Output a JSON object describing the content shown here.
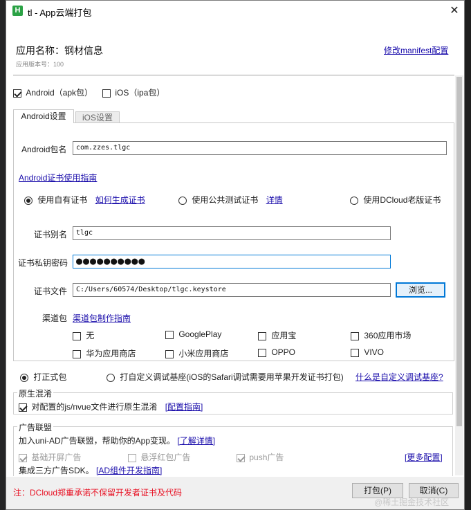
{
  "window": {
    "title": "tl - App云端打包",
    "logo_letter": "H",
    "close_glyph": "✕"
  },
  "app": {
    "name_label": "应用名称：钢材信息",
    "version_label": "应用版本号：100",
    "manifest_link": "修改manifest配置"
  },
  "platforms": {
    "android": {
      "label": "Android（apk包）",
      "checked": true
    },
    "ios": {
      "label": "iOS（ipa包）",
      "checked": false
    }
  },
  "tabs": [
    {
      "label": "Android设置",
      "active": true
    },
    {
      "label": "iOS设置",
      "active": false
    }
  ],
  "android": {
    "package_label": "Android包名",
    "package_value": "com.zzes.tlgc",
    "cert_guide_link": "Android证书使用指南",
    "cert_options": [
      {
        "label": "使用自有证书",
        "checked": true,
        "link": "如何生成证书"
      },
      {
        "label": "使用公共测试证书",
        "checked": false,
        "link": "详情"
      },
      {
        "label": "使用DCloud老版证书",
        "checked": false,
        "link": ""
      }
    ],
    "alias_label": "证书别名",
    "alias_value": "tlgc",
    "password_label": "证书私钥密码",
    "password_value": "●●●●●●●●●●",
    "file_label": "证书文件",
    "file_value": "C:/Users/60574/Desktop/tlgc.keystore",
    "browse_button": "浏览...",
    "channel_label": "渠道包",
    "channel_link": "渠道包制作指南",
    "channels": [
      {
        "label": "无",
        "checked": false
      },
      {
        "label": "GooglePlay",
        "checked": false
      },
      {
        "label": "应用宝",
        "checked": false
      },
      {
        "label": "360应用市场",
        "checked": false
      },
      {
        "label": "华为应用商店",
        "checked": false
      },
      {
        "label": "小米应用商店",
        "checked": false
      },
      {
        "label": "OPPO",
        "checked": false
      },
      {
        "label": "VIVO",
        "checked": false
      }
    ]
  },
  "build_mode": {
    "formal": {
      "label": "打正式包",
      "checked": true
    },
    "custom": {
      "label": "打自定义调试基座(iOS的Safari调试需要用苹果开发证书打包)",
      "checked": false
    },
    "custom_link": "什么是自定义调试基座?"
  },
  "obfuscation": {
    "title": "原生混淆",
    "checkbox_label": "对配置的js/nvue文件进行原生混淆",
    "checked": true,
    "guide_link": "[配置指南]"
  },
  "ads": {
    "title": "广告联盟",
    "join_text": "加入uni-AD广告联盟，帮助你的App变现。",
    "learn_more": "[了解详情]",
    "options": [
      {
        "label": "基础开屏广告",
        "checked": true
      },
      {
        "label": "悬浮红包广告",
        "checked": false
      },
      {
        "label": "push广告",
        "checked": true
      }
    ],
    "more_config": "[更多配置]",
    "sdk_text": "集成三方广告SDK。",
    "sdk_link": "[AD组件开发指南]"
  },
  "footer": {
    "warning": "注：DCloud郑重承诺不保留开发者证书及代码",
    "pack_button": "打包(P)",
    "cancel_button": "取消(C)",
    "watermark": "@稀土掘金技术社区"
  },
  "colors": {
    "link": "#1a0dab",
    "focus": "#0078d7",
    "warning": "#e81123",
    "logo": "#2ba245"
  }
}
